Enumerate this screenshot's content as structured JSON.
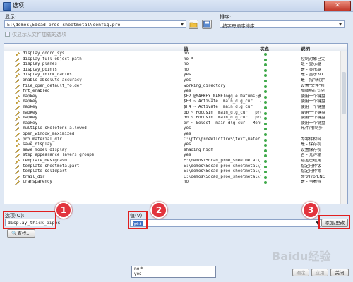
{
  "window": {
    "title": "选项",
    "close_label": "✕"
  },
  "display": {
    "label": "显示:",
    "path": "E:\\demos\\5dcad_proe_sheetmetal\\config.pro",
    "checkbox_label": "仅显示从文件加载的选项"
  },
  "sort": {
    "label": "排序:",
    "value": "按字母顺序排序"
  },
  "table": {
    "columns": [
      "",
      "值",
      "状态",
      "说明"
    ],
    "rows": [
      {
        "name": "display_coord_sys",
        "value": "no",
        "desc": ""
      },
      {
        "name": "display_full_object_path",
        "value": "no *",
        "desc": "控制对象已完"
      },
      {
        "name": "display_planes",
        "value": "no",
        "desc": "是 - 显示基"
      },
      {
        "name": "display_points",
        "value": "no",
        "desc": "是 - 显示基"
      },
      {
        "name": "display_thick_cables",
        "value": "yes",
        "desc": "是 - 显示3D"
      },
      {
        "name": "enable_absolute_accuracy",
        "value": "yes",
        "desc": "是 - 指\"精度\""
      },
      {
        "name": "file_open_default_folder",
        "value": "working_directory",
        "desc": "设置\"文件\"打"
      },
      {
        "name": "frt_enabled",
        "value": "yes",
        "desc": "加载特征识别"
      },
      {
        "name": "mapkey",
        "value": "$F2 @MAPKEY_NAMEToggle Datums;@MA...",
        "desc": "使用一个键盘"
      },
      {
        "name": "mapkey",
        "value": "$F3 ~ Activate `main_dlg_cur` `A...",
        "desc": "使用一个键盘"
      },
      {
        "name": "mapkey",
        "value": "$F4 ~ Activate `main_dlg_cur` `TA...",
        "desc": "使用一个键盘"
      },
      {
        "name": "mapkey",
        "value": "bb ~ FocusIn `main_dlg_cur` `proe...",
        "desc": "使用一个键盘"
      },
      {
        "name": "mapkey",
        "value": "dd ~ FocusIn `main_dlg_cur` `proe...",
        "desc": "使用一个键盘"
      },
      {
        "name": "mapkey",
        "value": "er ~ Select `main_dlg_cur` `MenuB...",
        "desc": "使用一个键盘"
      },
      {
        "name": "multiple_skeletons_allowed",
        "value": "yes",
        "desc": "允许/限制多"
      },
      {
        "name": "open_window_maximized",
        "value": "yes",
        "desc": ""
      },
      {
        "name": "pro_material_dir",
        "value": "C:\\ptc\\proeWildfire5\\text\\materia...",
        "desc": "为零件材料"
      },
      {
        "name": "save_display",
        "value": "yes",
        "desc": "是 - 保存视"
      },
      {
        "name": "save_model_display",
        "value": "shading_high",
        "desc": "设置保存视"
      },
      {
        "name": "step_appearance_layers_groups",
        "value": "yes",
        "desc": "否 - 允许输"
      },
      {
        "name": "template_designasm",
        "value": "E:\\demos\\5dcad_proe_sheetmetal\\te...",
        "desc": "指定已经用"
      },
      {
        "name": "template_sheetmetalpart",
        "value": "E:\\demos\\5dcad_proe_sheetmetal\\te...",
        "desc": "指定用作钣"
      },
      {
        "name": "template_solidpart",
        "value": "E:\\demos\\5dcad_proe_sheetmetal\\te...",
        "desc": "指定用作零"
      },
      {
        "name": "trail_dir",
        "value": "E:\\demos\\5dcad_proe_sheetmetal\\trail",
        "desc": "命令Pro/ENG"
      },
      {
        "name": "transparency",
        "value": "no",
        "desc": "是 - 当看得"
      }
    ]
  },
  "bottom": {
    "option_label": "选项(O):",
    "option_value": "display_thick_pipes",
    "find_label": "查找...",
    "value_label": "值(V):",
    "value_current": "yes",
    "dropdown_options": [
      "no *",
      "yes"
    ],
    "add_change_label": "添加/更改",
    "ok_label": "确定",
    "apply_label": "应用",
    "close_label": "关闭"
  },
  "annotations": [
    "1",
    "2",
    "3"
  ],
  "watermark": "Baidu经验",
  "colors": {
    "status_green": "#3fa94a",
    "highlight_red": "#e02020"
  }
}
